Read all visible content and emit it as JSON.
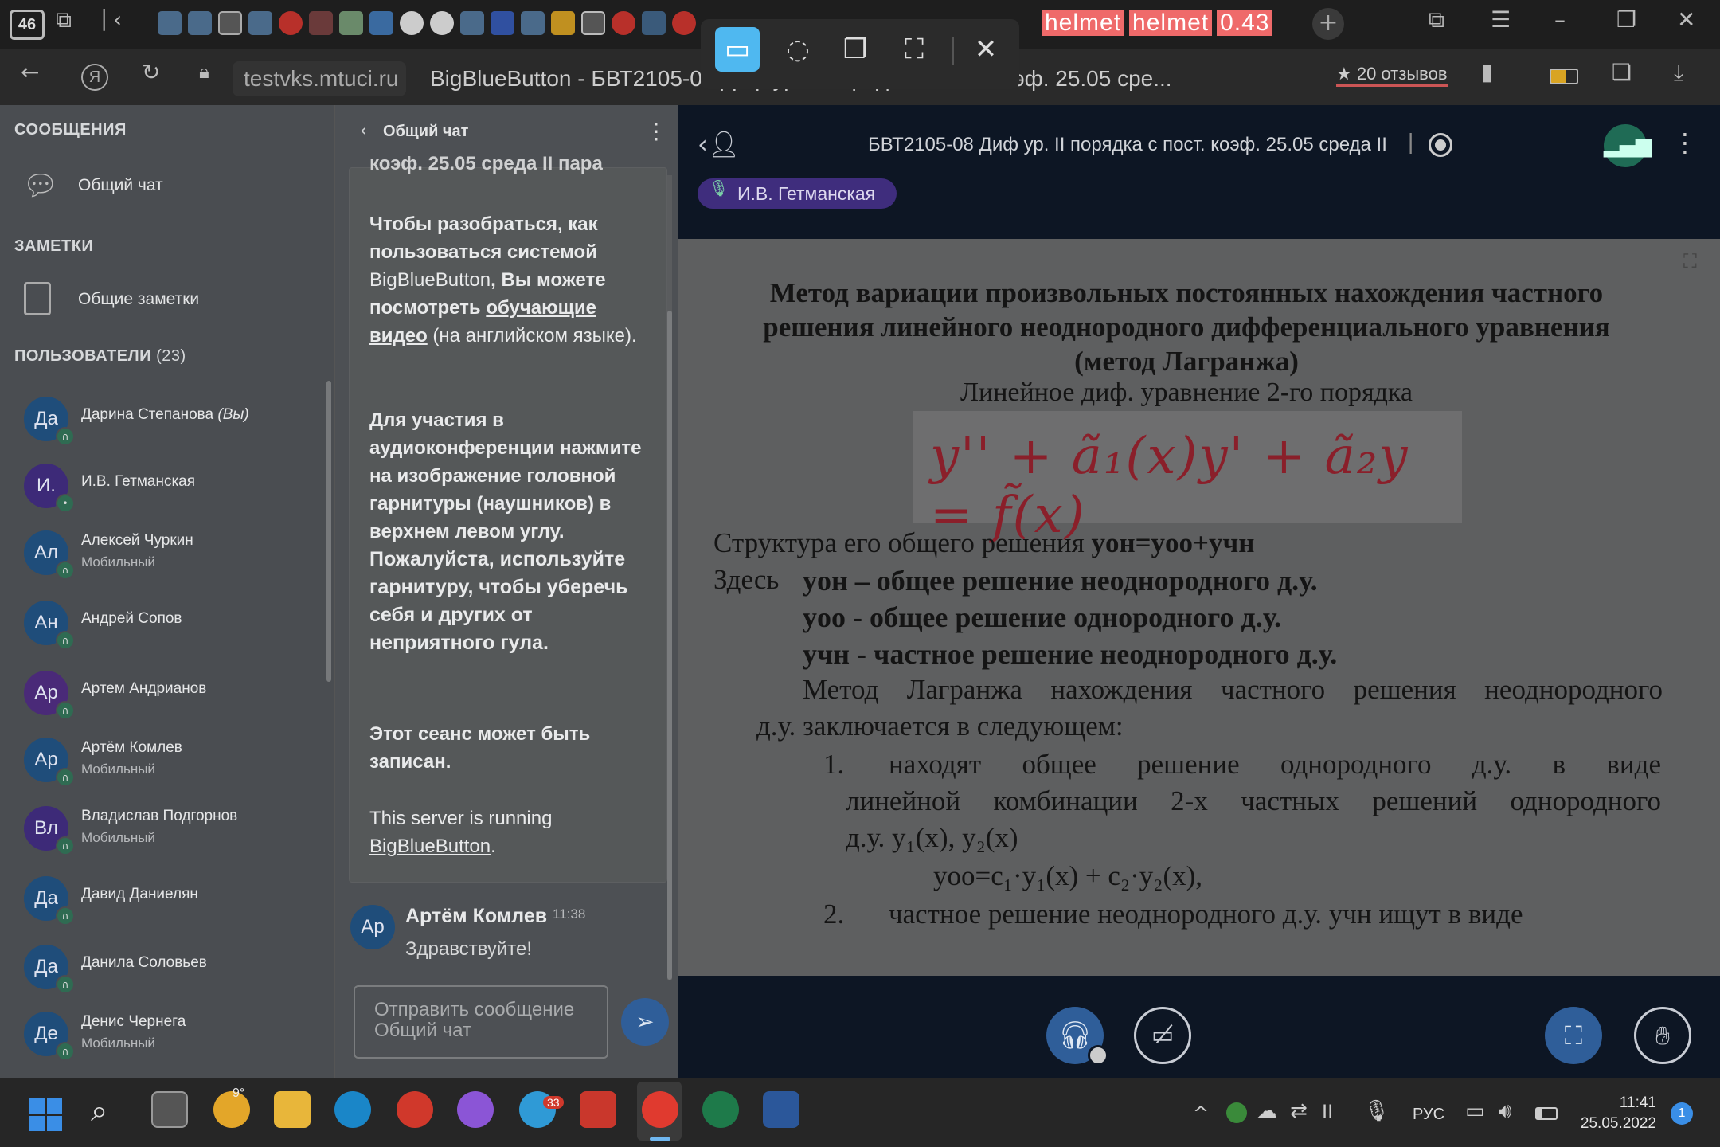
{
  "browser": {
    "tab_count": "46",
    "overlay_label_1": "helmet",
    "overlay_label_2": "helmet",
    "overlay_score": "0.43",
    "url": "testvks.mtuci.ru",
    "page_title": "BigBlueButton - БВТ2105-08 Диф ур. II порядка с пост. коэф. 25.05 сре...",
    "reviews": "20 отзывов"
  },
  "sidebar": {
    "messages_header": "СООБЩЕНИЯ",
    "public_chat_label": "Общий чат",
    "notes_header": "ЗАМЕТКИ",
    "shared_notes_label": "Общие заметки",
    "users_header": "ПОЛЬЗОВАТЕЛИ",
    "users_count": "(23)",
    "users": [
      {
        "initials": "Да",
        "name": "Дарина Степанова",
        "suffix": "(Вы)",
        "sub": "",
        "color": "#1f4d7a"
      },
      {
        "initials": "И.",
        "name": "И.В. Гетманская",
        "suffix": "",
        "sub": "",
        "color": "#3d2a78"
      },
      {
        "initials": "Ал",
        "name": "Алексей Чуркин",
        "suffix": "",
        "sub": "Мобильный",
        "color": "#1f4d7a"
      },
      {
        "initials": "Ан",
        "name": "Андрей Сопов",
        "suffix": "",
        "sub": "",
        "color": "#1f4d7a"
      },
      {
        "initials": "Ар",
        "name": "Артем Андрианов",
        "suffix": "",
        "sub": "",
        "color": "#4a2a78"
      },
      {
        "initials": "Ар",
        "name": "Артём Комлев",
        "suffix": "",
        "sub": "Мобильный",
        "color": "#1f4d7a"
      },
      {
        "initials": "Вл",
        "name": "Владислав Подгорнов",
        "suffix": "",
        "sub": "Мобильный",
        "color": "#3d2a78"
      },
      {
        "initials": "Да",
        "name": "Давид Даниелян",
        "suffix": "",
        "sub": "",
        "color": "#1f4d7a"
      },
      {
        "initials": "Да",
        "name": "Данила Соловьев",
        "suffix": "",
        "sub": "",
        "color": "#1f4d7a"
      },
      {
        "initials": "Де",
        "name": "Денис Чернега",
        "suffix": "",
        "sub": "Мобильный",
        "color": "#1f4d7a"
      }
    ]
  },
  "chat": {
    "header": "Общий чат",
    "cutoff_line": "коэф. 25.05 среда II пара",
    "welcome_p1_a": "Чтобы разобраться, как пользоваться системой ",
    "welcome_p1_b": "BigBlueButton",
    "welcome_p1_c": ", Вы можете посмотреть ",
    "welcome_p1_link": "обучающие видео",
    "welcome_p1_d": " (на английском языке).",
    "welcome_p2": "Для участия в аудиоконференции нажмите на изображение головной гарнитуры (наушников) в верхнем левом углу.",
    "welcome_p2_strong": "Пожалуйста, используйте гарнитуру, чтобы уберечь себя и других от неприятного гула.",
    "welcome_p3": "Этот сеанс может быть записан.",
    "welcome_p4_a": "This server is running ",
    "welcome_p4_link": "BigBlueButton",
    "welcome_p4_b": ".",
    "message": {
      "initials": "Ар",
      "author": "Артём Комлев",
      "time": "11:38",
      "text": "Здравствуйте!"
    },
    "input_placeholder_1": "Отправить сообщение",
    "input_placeholder_2": "Общий чат"
  },
  "presentation": {
    "meeting_title": "БВТ2105-08 Диф ур. II порядка с пост. коэф. 25.05 среда II ...",
    "presenter": "И.В. Гетманская",
    "slide": {
      "title_1": "Метод вариации произвольных постоянных нахождения частного",
      "title_2": "решения линейного неоднородного дифференциального уравнения",
      "title_3": "(метод Лагранжа)",
      "subtitle": "Линейное диф. уравнение 2-го порядка",
      "formula_handwritten": "y'' + ã₁(x)y' + ã₂y = f̃(x)",
      "structure_label": "Структура его общего решения ",
      "structure_eq": "yон=yоо+yчн",
      "here": "Здесь",
      "def1_sym": "yон",
      "def1_text": " – общее решение неоднородного д.у.",
      "def2_sym": "yоо",
      "def2_text": " - общее решение однородного д.у.",
      "def3_sym": "yчн",
      "def3_text": " - частное решение неоднородного д.у.",
      "method_1": "Метод Лагранжа нахождения частного решения неоднородного",
      "method_2": "д.у. заключается в следующем:",
      "step1_num": "1.",
      "step1_a": "находят общее решение однородного д.у. в виде",
      "step1_b": "линейной комбинации 2-х частных решений однородного",
      "step1_c": "д.у. y₁(x), y₂(x)",
      "step1_eq": "yоо=c₁·y₁(x) + c₂·y₂(x),",
      "step2_num": "2.",
      "step2_text": "частное решение неоднородного д.у. yчн ищут в виде"
    }
  },
  "taskbar": {
    "weather_temp": "9°",
    "telegram_badge": "33",
    "language": "РУС",
    "time": "11:41",
    "date": "25.05.2022",
    "notifications": "1"
  },
  "colors": {
    "accent_blue": "#2f5e99",
    "topbar_dark": "#0d1624",
    "presenter_pill": "#3f2d7d",
    "stats_green": "#1f6b55"
  }
}
